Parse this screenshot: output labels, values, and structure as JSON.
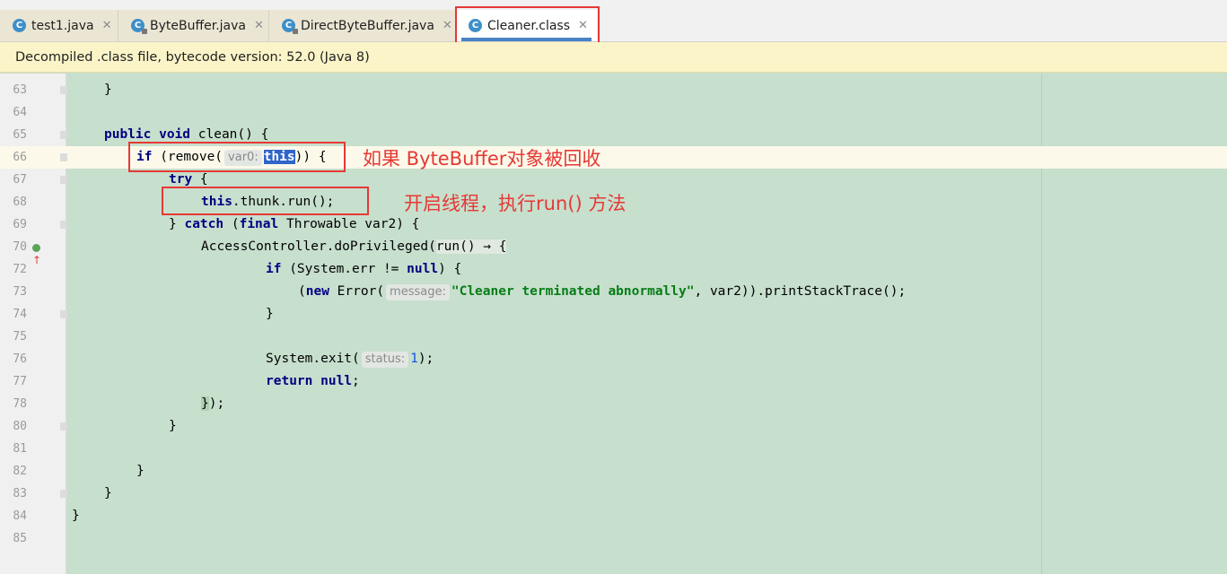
{
  "tabs": [
    {
      "label": "test1.java",
      "icon": "java-class-icon",
      "active": false
    },
    {
      "label": "ByteBuffer.java",
      "icon": "java-class-icon",
      "active": false
    },
    {
      "label": "DirectByteBuffer.java",
      "icon": "java-class-icon",
      "active": false
    },
    {
      "label": "Cleaner.class",
      "icon": "java-class-icon",
      "active": true
    }
  ],
  "icons": {
    "class_glyph": "C",
    "close_glyph": "✕",
    "override_glyph": "↑"
  },
  "banner": {
    "text": "Decompiled .class file, bytecode version: 52.0 (Java 8)"
  },
  "editor": {
    "lines": [
      "63",
      "64",
      "65",
      "66",
      "67",
      "68",
      "69",
      "70",
      "72",
      "73",
      "74",
      "75",
      "76",
      "77",
      "78",
      "80",
      "81",
      "82",
      "83",
      "84",
      "85"
    ],
    "code": {
      "l63": "}",
      "l65_a": "public void",
      "l65_b": " clean() {",
      "l66_if": "if",
      "l66_a": " (remove(",
      "l66_hint": "var0:",
      "l66_this": "this",
      "l66_b": ")) {",
      "l67": "try",
      "l67_b": " {",
      "l68_this": "this",
      "l68_b": ".thunk.run();",
      "l69_a": "} ",
      "l69_catch": "catch",
      "l69_b": " (",
      "l69_final": "final",
      "l69_c": " Throwable var2) {",
      "l70_a": "AccessController.doPrivileged(",
      "l70_lambda": "run() → {",
      "l72_if": "if",
      "l72_a": " (System.err != ",
      "l72_null": "null",
      "l72_b": ") {",
      "l73_a": "(",
      "l73_new": "new",
      "l73_b": " Error(",
      "l73_hint": "message:",
      "l73_str": "\"Cleaner terminated abnormally\"",
      "l73_c": ", var2)).printStackTrace();",
      "l74": "}",
      "l76_a": "System.exit(",
      "l76_hint": "status:",
      "l76_num": "1",
      "l76_b": ");",
      "l77_ret": "return",
      "l77_null": "null",
      "l77_b": ";",
      "l78_brace": "}",
      "l78_b": ");",
      "l80": "}",
      "l82": "}",
      "l83": "}",
      "l84": "}"
    }
  },
  "annotations": {
    "recycled": "如果 ByteBuffer对象被回收",
    "run_thread": "开启线程，执行run()  方法"
  },
  "colors": {
    "annotation": "#e53935",
    "editor_bg": "#c7dfcd",
    "keyword": "#000080",
    "string": "#067d17",
    "selection": "#2f65ca"
  }
}
